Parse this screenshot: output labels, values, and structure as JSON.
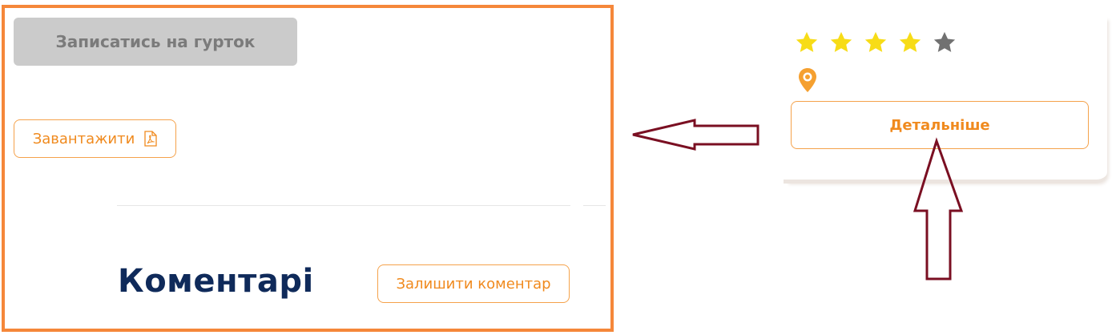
{
  "left_panel": {
    "enroll_label": "Записатись на гурток",
    "download_label": "Завантажити",
    "comments_title": "Коментарі",
    "leave_comment_label": "Залишити коментар"
  },
  "right_card": {
    "rating": 4,
    "rating_max": 5,
    "details_label": "Детальніше",
    "location_icon": "location-pin-icon"
  },
  "colors": {
    "highlight_border": "#f5873a",
    "accent": "#f08a1e",
    "disabled_bg": "#cbcbcb",
    "title": "#0f2a5a",
    "star_filled": "#f7dc17",
    "star_empty": "#717171",
    "annotation_arrow": "#7a0f22"
  }
}
